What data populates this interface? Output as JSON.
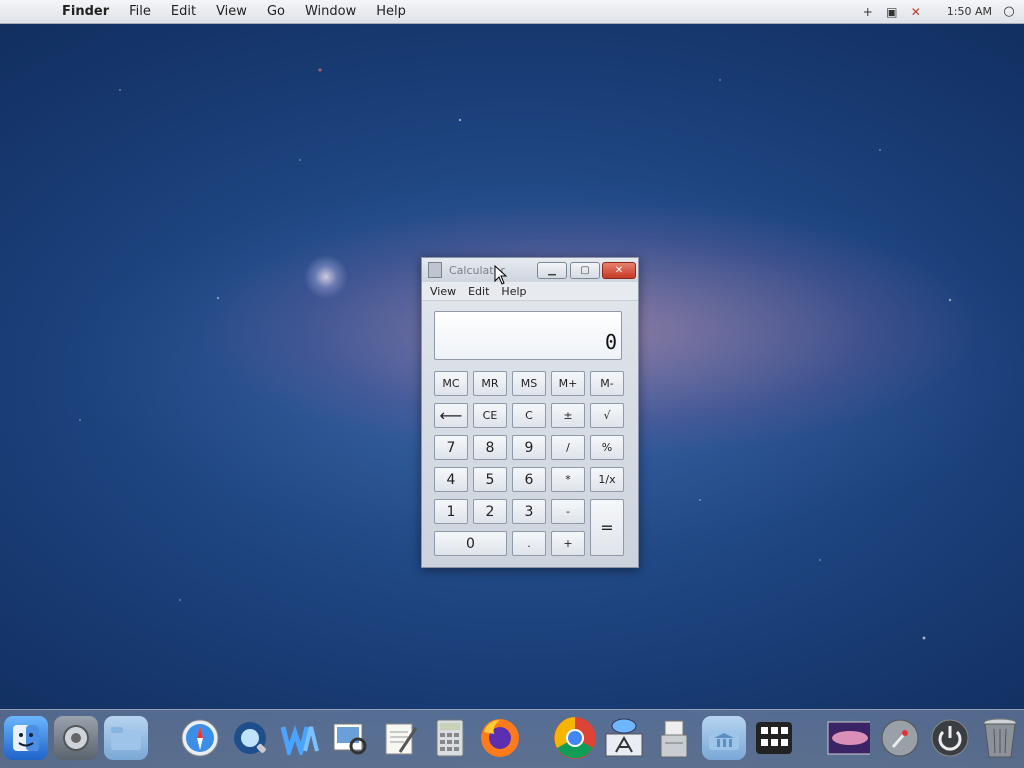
{
  "menubar": {
    "app": "Finder",
    "items": [
      "File",
      "Edit",
      "View",
      "Go",
      "Window",
      "Help"
    ],
    "clock": "1:50 AM"
  },
  "calculator": {
    "title": "Calculator",
    "menu": [
      "View",
      "Edit",
      "Help"
    ],
    "display": "0",
    "keys": {
      "mc": "MC",
      "mr": "MR",
      "ms": "MS",
      "mplus": "M+",
      "mminus": "M-",
      "back": "⟵",
      "ce": "CE",
      "c": "C",
      "plusminus": "±",
      "sqrt": "√",
      "seven": "7",
      "eight": "8",
      "nine": "9",
      "divide": "/",
      "percent": "%",
      "four": "4",
      "five": "5",
      "six": "6",
      "multiply": "*",
      "reciprocal": "1/x",
      "one": "1",
      "two": "2",
      "three": "3",
      "minus": "-",
      "equals": "=",
      "zero": "0",
      "dot": ".",
      "plus": "+"
    }
  },
  "dock": {
    "icons": [
      "finder-icon",
      "system-preferences-icon",
      "applications-folder-icon",
      "safari-icon",
      "quicktime-icon",
      "mail-icon",
      "preview-icon",
      "textedit-icon",
      "calculator-icon",
      "firefox-icon",
      "chrome-icon",
      "app-store-icon",
      "disk-utility-icon",
      "library-folder-icon",
      "dashboard-icon",
      "photo-icon",
      "launchpad-icon",
      "power-icon",
      "trash-icon"
    ]
  },
  "colors": {
    "close": "#c53a26",
    "menubar": "#dfe2e8",
    "desktop": "#1a3e78"
  }
}
